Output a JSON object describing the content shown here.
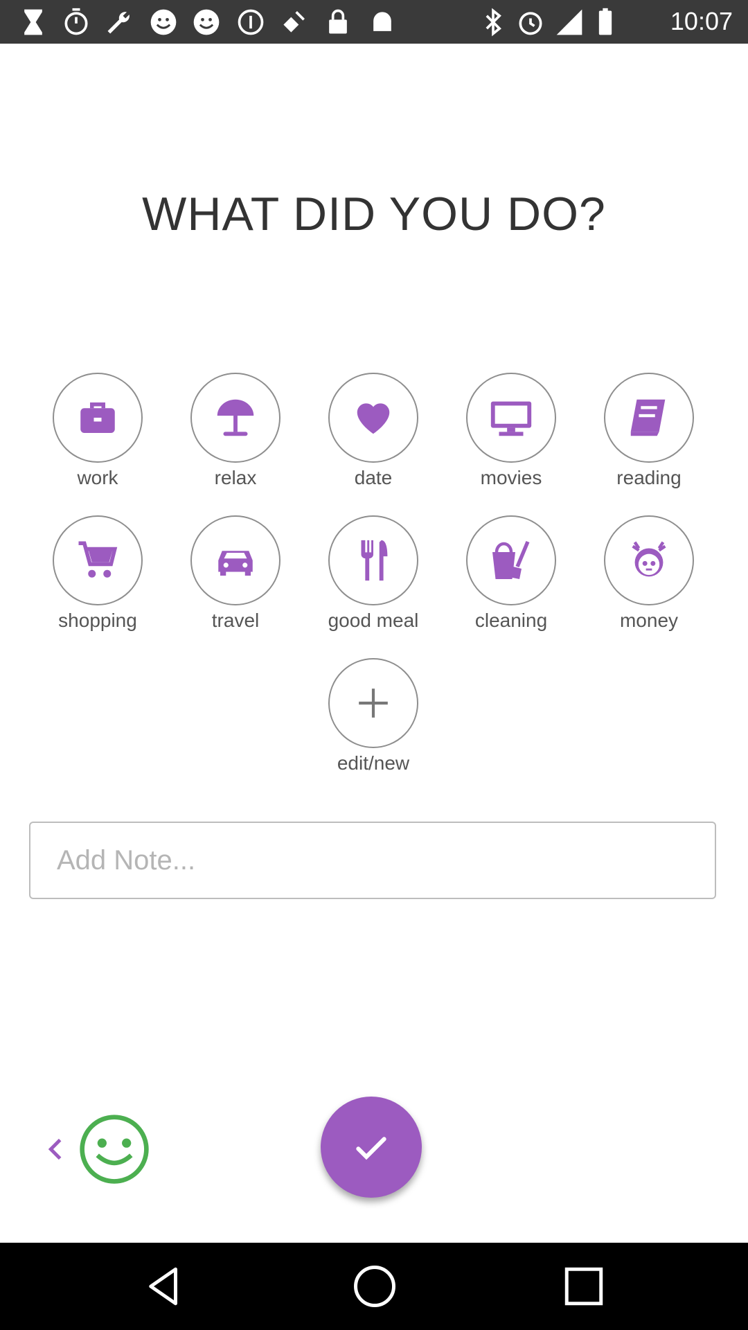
{
  "status_bar": {
    "time": "10:07",
    "icons": [
      "hourglass-icon",
      "stopwatch-icon",
      "wrench-icon",
      "smiley-icon",
      "smiley-icon",
      "info-icon",
      "satellite-icon",
      "lock-icon",
      "android-icon",
      "bluetooth-icon",
      "alarm-icon",
      "signal-icon",
      "battery-icon"
    ]
  },
  "title": "WHAT DID YOU DO?",
  "activities": [
    {
      "label": "work",
      "icon": "briefcase-icon"
    },
    {
      "label": "relax",
      "icon": "umbrella-icon"
    },
    {
      "label": "date",
      "icon": "heart-icon"
    },
    {
      "label": "movies",
      "icon": "monitor-icon"
    },
    {
      "label": "reading",
      "icon": "book-icon"
    },
    {
      "label": "shopping",
      "icon": "cart-icon"
    },
    {
      "label": "travel",
      "icon": "car-icon"
    },
    {
      "label": "good meal",
      "icon": "fork-knife-icon"
    },
    {
      "label": "cleaning",
      "icon": "bucket-brush-icon"
    },
    {
      "label": "money",
      "icon": "girl-face-icon"
    },
    {
      "label": "edit/new",
      "icon": "plus-icon"
    }
  ],
  "note": {
    "placeholder": "Add Note..."
  },
  "colors": {
    "accent": "#9c5bc0",
    "mood": "#4caf50",
    "statusbar": "#3a3a3a"
  }
}
